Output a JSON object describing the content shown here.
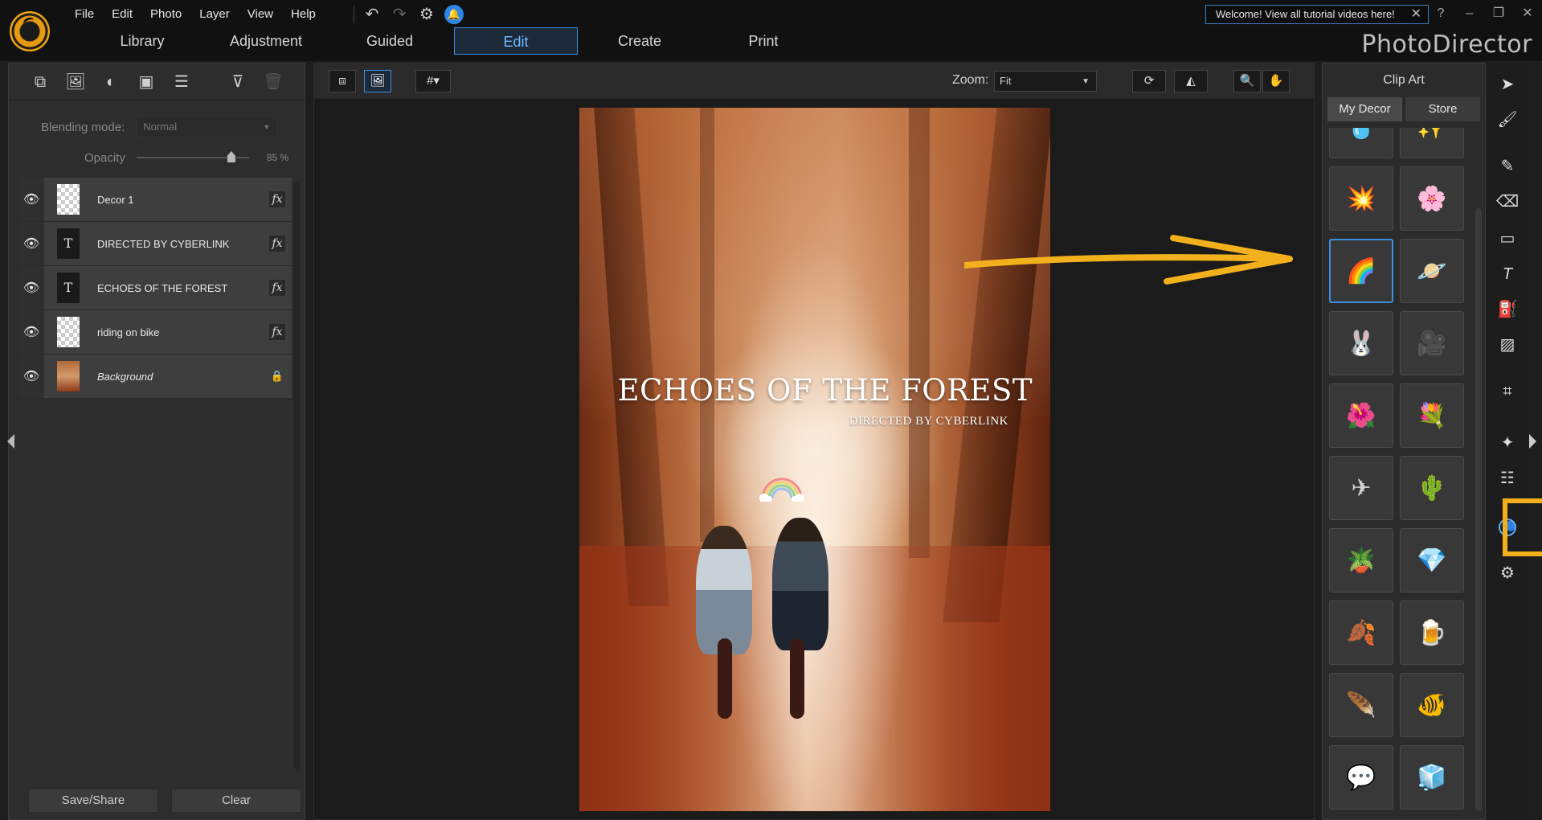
{
  "menu": [
    "File",
    "Edit",
    "Photo",
    "Layer",
    "View",
    "Help"
  ],
  "tabs": [
    "Library",
    "Adjustment",
    "Guided",
    "Edit",
    "Create",
    "Print"
  ],
  "active_tab": "Edit",
  "welcome_text": "Welcome! View all tutorial videos here!",
  "brand": "PhotoDirector",
  "left_panel": {
    "blending_label": "Blending mode:",
    "blending_value": "Normal",
    "opacity_label": "Opacity",
    "opacity_value": "85 %",
    "layers": [
      {
        "name": "Decor 1"
      },
      {
        "name": "DIRECTED BY CYBERLINK"
      },
      {
        "name": "ECHOES OF THE FOREST"
      },
      {
        "name": "riding on bike"
      },
      {
        "name": "Background"
      }
    ],
    "save_label": "Save/Share",
    "clear_label": "Clear"
  },
  "center": {
    "zoom_label": "Zoom:",
    "zoom_value": "Fit",
    "poster_title": "ECHOES OF THE FOREST",
    "poster_subtitle": "DIRECTED BY CYBERLINK"
  },
  "right_panel": {
    "title": "Clip Art",
    "tab_my_decor": "My Decor",
    "tab_store": "Store"
  },
  "colors": {
    "accent": "#3d8fe0",
    "highlight": "#f2b01c"
  }
}
